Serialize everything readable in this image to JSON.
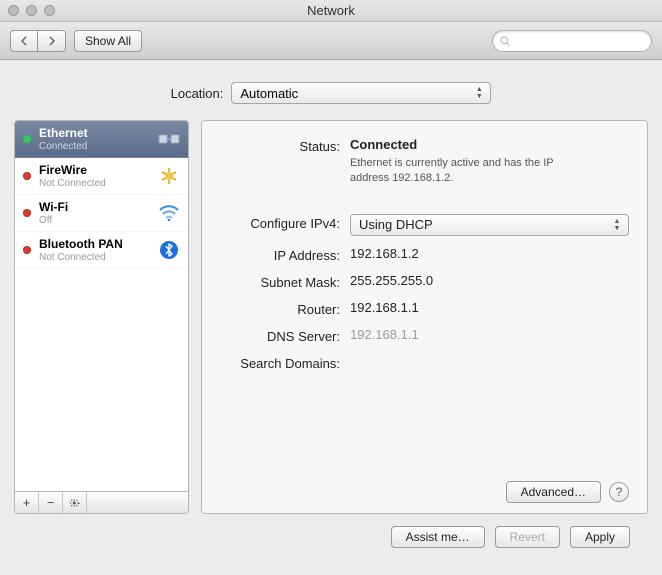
{
  "window": {
    "title": "Network"
  },
  "toolbar": {
    "showall": "Show All",
    "search_placeholder": ""
  },
  "location": {
    "label": "Location:",
    "value": "Automatic"
  },
  "sidebar": {
    "items": [
      {
        "name": "Ethernet",
        "status": "Connected",
        "dot": "green",
        "selected": true,
        "icon": "ethernet"
      },
      {
        "name": "FireWire",
        "status": "Not Connected",
        "dot": "red",
        "selected": false,
        "icon": "firewire"
      },
      {
        "name": "Wi-Fi",
        "status": "Off",
        "dot": "red",
        "selected": false,
        "icon": "wifi"
      },
      {
        "name": "Bluetooth PAN",
        "status": "Not Connected",
        "dot": "red",
        "selected": false,
        "icon": "bluetooth"
      }
    ]
  },
  "detail": {
    "status_label": "Status:",
    "status_value": "Connected",
    "status_sub": "Ethernet is currently active and has the IP address 192.168.1.2.",
    "configure_label": "Configure IPv4:",
    "configure_value": "Using DHCP",
    "ip_label": "IP Address:",
    "ip_value": "192.168.1.2",
    "mask_label": "Subnet Mask:",
    "mask_value": "255.255.255.0",
    "router_label": "Router:",
    "router_value": "192.168.1.1",
    "dns_label": "DNS Server:",
    "dns_value": "192.168.1.1",
    "search_label": "Search Domains:",
    "search_value": "",
    "advanced": "Advanced…"
  },
  "footer": {
    "assist": "Assist me…",
    "revert": "Revert",
    "apply": "Apply"
  }
}
